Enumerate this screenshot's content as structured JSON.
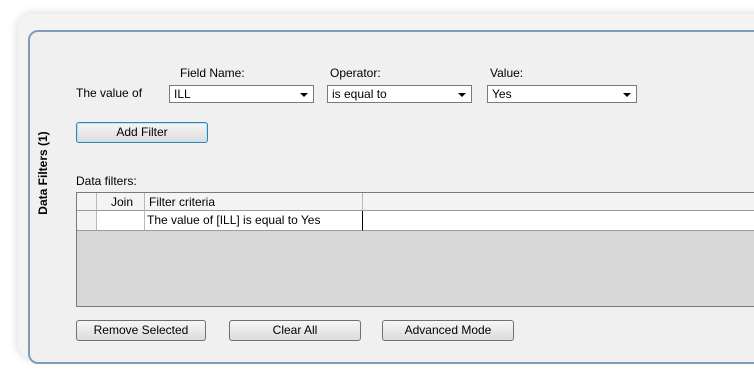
{
  "group": {
    "title": "Data Filters (1)"
  },
  "builder": {
    "prefix_label": "The value of",
    "field_label": "Field Name:",
    "field_value": "ILL",
    "operator_label": "Operator:",
    "operator_value": "is equal to",
    "value_label": "Value:",
    "value_value": "Yes",
    "add_button": "Add Filter"
  },
  "filters": {
    "label": "Data filters:",
    "columns": [
      "Join",
      "Filter criteria"
    ],
    "rows": [
      {
        "join": "",
        "criteria": "The value of [ILL] is equal to Yes"
      }
    ]
  },
  "buttons": {
    "remove_selected": "Remove Selected",
    "clear_all": "Clear All",
    "advanced_mode": "Advanced Mode"
  }
}
